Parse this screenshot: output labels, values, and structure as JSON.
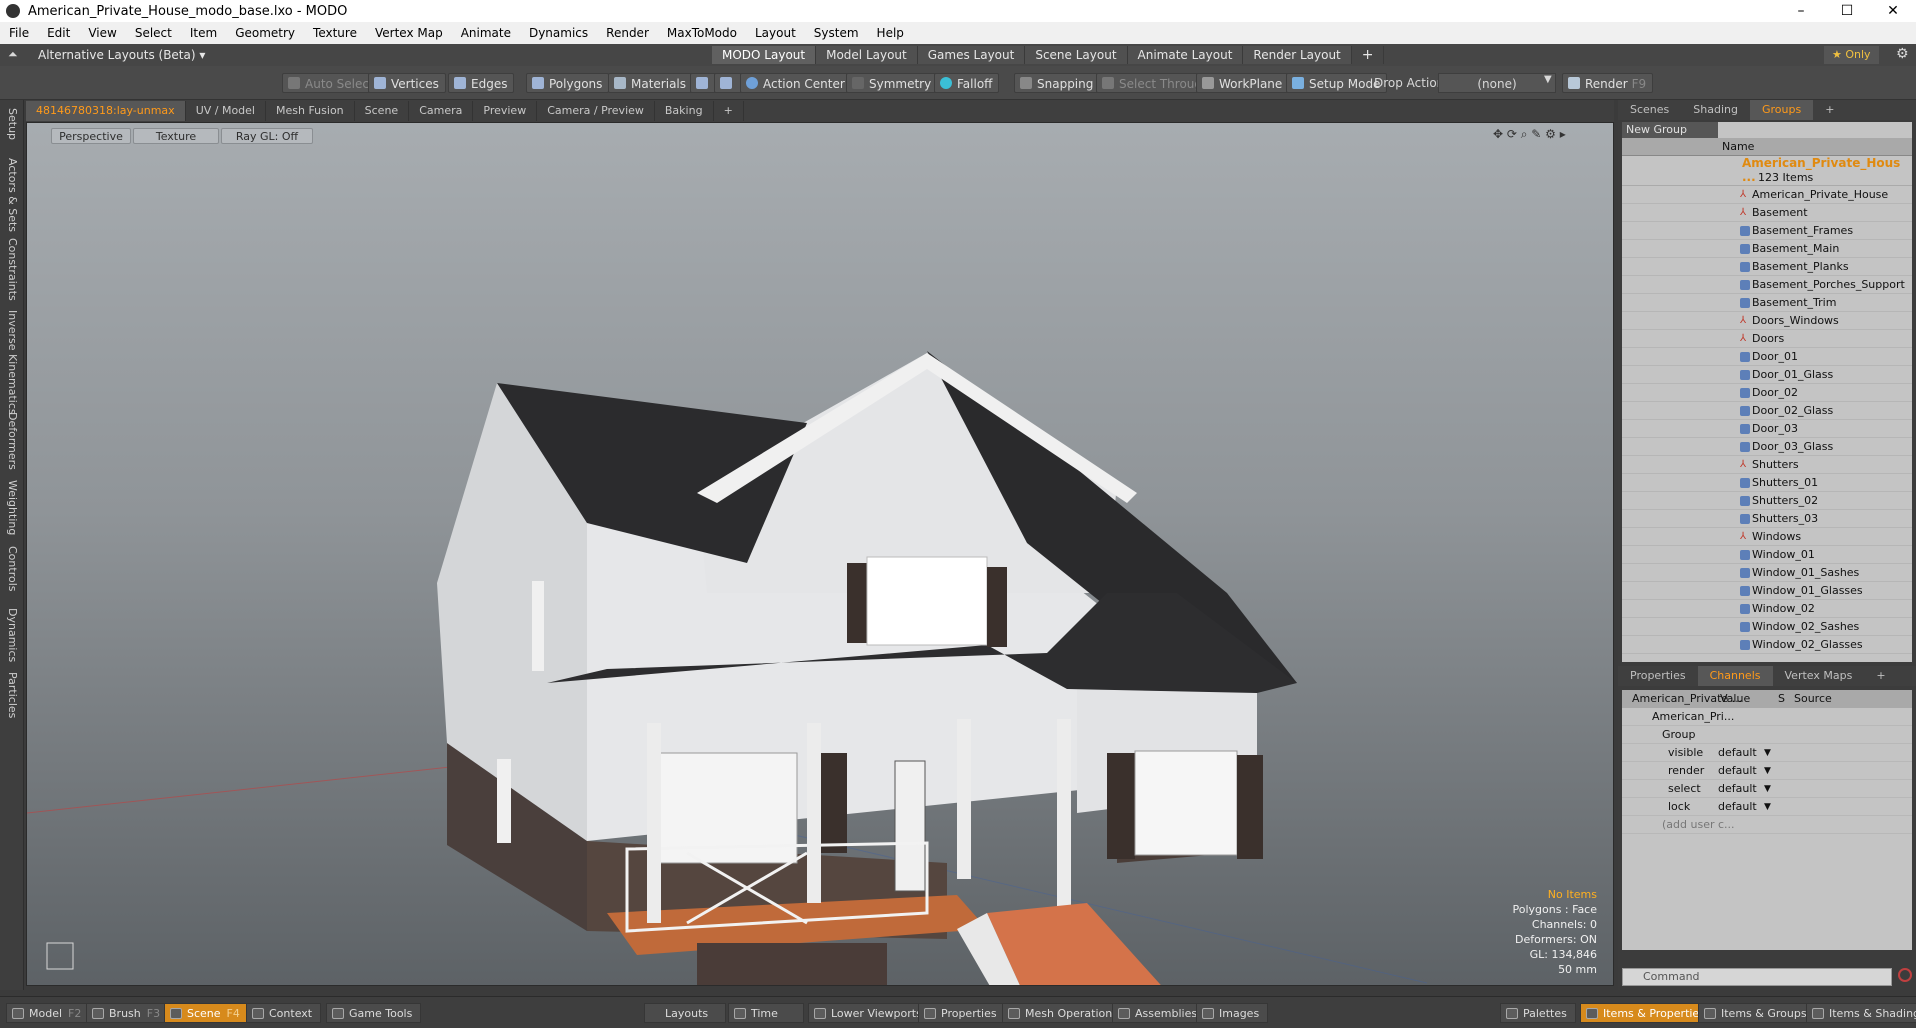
{
  "window": {
    "title": "American_Private_House_modo_base.lxo - MODO",
    "minimize": "–",
    "maximize": "☐",
    "close": "✕"
  },
  "menu": [
    "File",
    "Edit",
    "View",
    "Select",
    "Item",
    "Geometry",
    "Texture",
    "Vertex Map",
    "Animate",
    "Dynamics",
    "Render",
    "MaxToModo",
    "Layout",
    "System",
    "Help"
  ],
  "layoutbar": {
    "alt_layouts": "Alternative Layouts (Beta) ▾",
    "tabs": [
      "MODO Layout",
      "Model Layout",
      "Games Layout",
      "Scene Layout",
      "Animate Layout",
      "Render Layout"
    ],
    "active_tab": "MODO Layout",
    "add": "+",
    "only": "★  Only",
    "gear": "⚙"
  },
  "toolbar": {
    "auto_select": "Auto Select",
    "vertices": "Vertices",
    "edges": "Edges",
    "polygons": "Polygons",
    "materials": "Materials",
    "action_center": "Action Center",
    "symmetry": "Symmetry",
    "falloff": "Falloff",
    "snapping": "Snapping",
    "select_through": "Select Through",
    "workplane": "WorkPlane",
    "setup_mode": "Setup Mode",
    "drop_action": "Drop Action",
    "drop_value": "(none)",
    "render": "Render",
    "render_key": "F9"
  },
  "left_tabs": [
    "Setup",
    "Actors & Sets",
    "Constraints",
    "Inverse Kinematics",
    "Deformers",
    "Weighting",
    "Controls",
    "Dynamics",
    "Particles"
  ],
  "viewport_tabs": [
    "48146780318:lay-unmax",
    "UV / Model",
    "Mesh Fusion",
    "Scene",
    "Camera",
    "Preview",
    "Camera / Preview",
    "Baking",
    "+"
  ],
  "viewport": {
    "perspective": "Perspective",
    "texture": "Texture",
    "raygl": "Ray GL: Off",
    "hud": {
      "no_items": "No Items",
      "polygons": "Polygons : Face",
      "channels": "Channels: 0",
      "deformers": "Deformers: ON",
      "gl": "GL: 134,846",
      "scale": "50 mm"
    }
  },
  "right_top_tabs": [
    "Scenes",
    "Shading",
    "Groups",
    "+"
  ],
  "groups": {
    "new_group": "New Group",
    "col_name": "Name",
    "root": "American_Private_Hous ...",
    "root_count": "123 Items",
    "items": [
      "American_Private_House",
      "Basement",
      "Basement_Frames",
      "Basement_Main",
      "Basement_Planks",
      "Basement_Porches_Support",
      "Basement_Trim",
      "Doors_Windows",
      "Doors",
      "Door_01",
      "Door_01_Glass",
      "Door_02",
      "Door_02_Glass",
      "Door_03",
      "Door_03_Glass",
      "Shutters",
      "Shutters_01",
      "Shutters_02",
      "Shutters_03",
      "Windows",
      "Window_01",
      "Window_01_Sashes",
      "Window_01_Glasses",
      "Window_02",
      "Window_02_Sashes",
      "Window_02_Glasses"
    ],
    "locators": [
      "American_Private_House",
      "Basement",
      "Doors_Windows",
      "Doors",
      "Shutters",
      "Windows"
    ]
  },
  "right_bottom_tabs": [
    "Properties",
    "Channels",
    "Vertex Maps",
    "+"
  ],
  "channels": {
    "col_item": "American_Private ...",
    "col_value": "Value",
    "col_s": "S",
    "col_source": "Source",
    "root": "American_Pri...",
    "group": "Group",
    "rows": [
      {
        "name": "visible",
        "value": "default"
      },
      {
        "name": "render",
        "value": "default"
      },
      {
        "name": "select",
        "value": "default"
      },
      {
        "name": "lock",
        "value": "default"
      }
    ],
    "add_user": "(add user c..."
  },
  "command": {
    "placeholder": "Command"
  },
  "statusbar": {
    "left": [
      {
        "label": "Model",
        "key": "F2"
      },
      {
        "label": "Brush",
        "key": "F3"
      },
      {
        "label": "Scene",
        "key": "F4"
      },
      {
        "label": "Context",
        "key": ""
      },
      {
        "label": "Game Tools",
        "key": ""
      }
    ],
    "center": [
      "Layouts",
      "Time",
      "Lower Viewports",
      "Properties",
      "Mesh Operations",
      "Assemblies",
      "Images"
    ],
    "right": [
      "Palettes",
      "Items & Properties",
      "Items & Groups",
      "Items & Shading"
    ]
  },
  "colors": {
    "accent": "#ff9a1a",
    "active_tab": "#d78a1c"
  }
}
